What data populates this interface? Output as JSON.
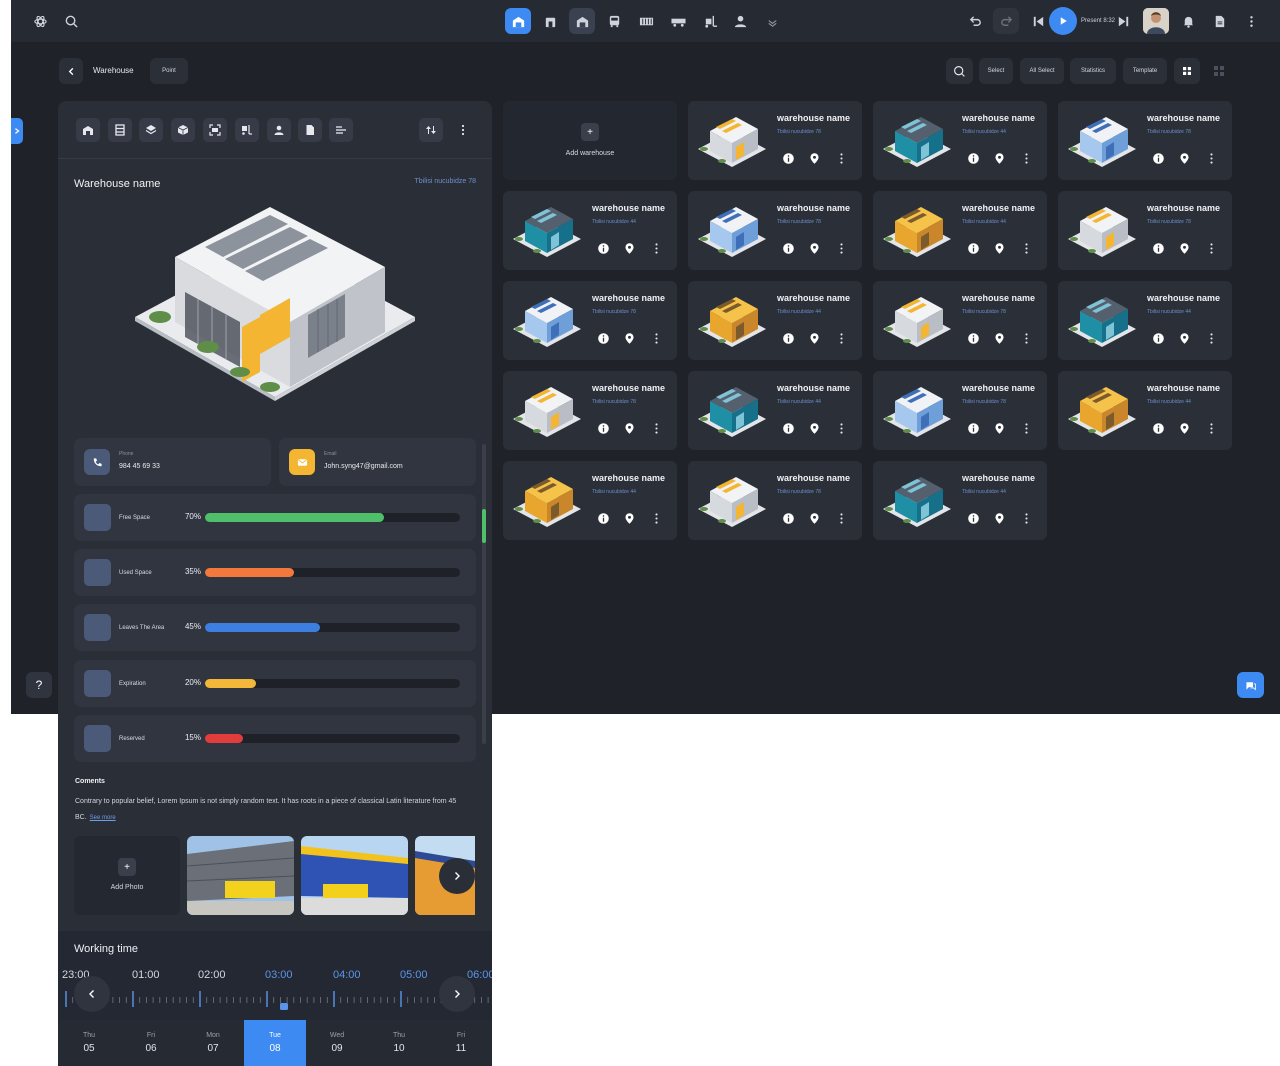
{
  "header": {
    "breadcrumb": "Warehouse",
    "point_label": "Point",
    "select_label": "Select",
    "all_select_label": "All Select",
    "statistics_label": "Statistics",
    "template_label": "Template",
    "present_label": "Present 8:32"
  },
  "detail": {
    "title": "Warehouse name",
    "address": "Tbilisi nucubidze 78",
    "phone_label": "Phone",
    "phone": "984 45 69 33",
    "email_label": "Email",
    "email": "John.syng47@gmail.com",
    "stats": [
      {
        "label": "Free Space",
        "percent": "70%",
        "value": 70,
        "color": "#4fbf6a"
      },
      {
        "label": "Used Space",
        "percent": "35%",
        "value": 35,
        "color": "#f2793b"
      },
      {
        "label": "Leaves The Area",
        "percent": "45%",
        "value": 45,
        "color": "#3d7fe0"
      },
      {
        "label": "Expiration",
        "percent": "20%",
        "value": 20,
        "color": "#f3b73a"
      },
      {
        "label": "Reserved",
        "percent": "15%",
        "value": 15,
        "color": "#e23d3d"
      }
    ],
    "comments_title": "Coments",
    "comments_text": "Contrary to popular belief, Lorem Ipsum is not simply random text. It has roots in a piece of classical Latin literature from 45 BC.",
    "see_more": "See more",
    "add_photo": "Add Photo"
  },
  "working_time": {
    "title": "Working time",
    "hours": [
      "23:00",
      "01:00",
      "02:00",
      "03:00",
      "04:00",
      "05:00",
      "06:00"
    ],
    "days": [
      {
        "name": "Thu",
        "date": "05"
      },
      {
        "name": "Fri",
        "date": "06"
      },
      {
        "name": "Mon",
        "date": "07"
      },
      {
        "name": "Tue",
        "date": "08"
      },
      {
        "name": "Wed",
        "date": "09"
      },
      {
        "name": "Thu",
        "date": "10"
      },
      {
        "name": "Fri",
        "date": "11"
      }
    ],
    "selected_day": 3
  },
  "grid": {
    "add_label": "Add warehouse",
    "cards": [
      {
        "name": "warehouse name",
        "address": "Tbilisi nucubidze 78",
        "style": "white"
      },
      {
        "name": "warehouse name",
        "address": "Tbilisi nucubidze 44",
        "style": "teal"
      },
      {
        "name": "warehouse name",
        "address": "Tbilisi nucubidze 78",
        "style": "blue"
      },
      {
        "name": "warehouse name",
        "address": "Tbilisi nucubidze 44",
        "style": "teal"
      },
      {
        "name": "warehouse name",
        "address": "Tbilisi nucubidze 78",
        "style": "blue"
      },
      {
        "name": "warehouse name",
        "address": "Tbilisi nucubidze 44",
        "style": "yellow"
      },
      {
        "name": "warehouse name",
        "address": "Tbilisi nucubidze 78",
        "style": "white"
      },
      {
        "name": "warehouse name",
        "address": "Tbilisi nucubidze 78",
        "style": "blue"
      },
      {
        "name": "warehouse name",
        "address": "Tbilisi nucubidze 44",
        "style": "yellow"
      },
      {
        "name": "warehouse name",
        "address": "Tbilisi nucubidze 78",
        "style": "white"
      },
      {
        "name": "warehouse name",
        "address": "Tbilisi nucubidze 44",
        "style": "teal"
      },
      {
        "name": "warehouse name",
        "address": "Tbilisi nucubidze 78",
        "style": "white"
      },
      {
        "name": "warehouse name",
        "address": "Tbilisi nucubidze 44",
        "style": "teal"
      },
      {
        "name": "warehouse name",
        "address": "Tbilisi nucubidze 78",
        "style": "blue"
      },
      {
        "name": "warehouse name",
        "address": "Tbilisi nucubidze 44",
        "style": "yellow"
      },
      {
        "name": "warehouse name",
        "address": "Tbilisi nucubidze 44",
        "style": "yellow"
      },
      {
        "name": "warehouse name",
        "address": "Tbilisi nucubidze 78",
        "style": "white"
      },
      {
        "name": "warehouse name",
        "address": "Tbilisi nucubidze 44",
        "style": "teal"
      }
    ]
  },
  "colors": {
    "accent": "#3d8bf2",
    "background": "#1f2229",
    "card": "#2b2f38"
  }
}
